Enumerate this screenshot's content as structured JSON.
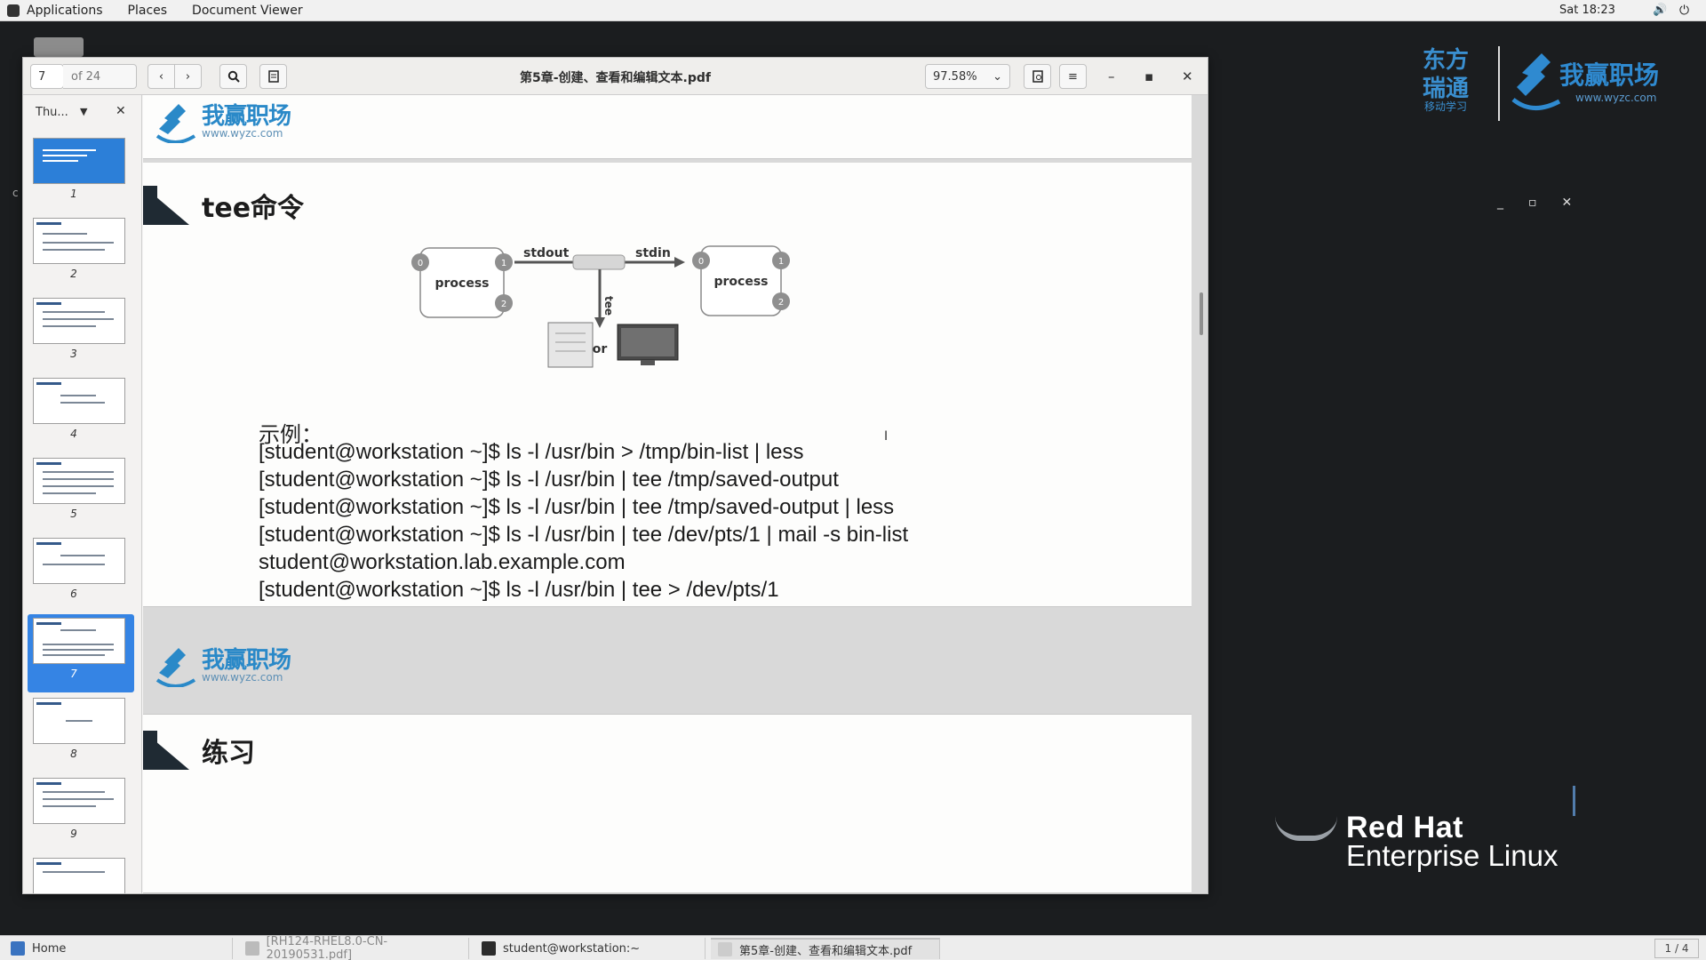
{
  "topbar": {
    "applications": "Applications",
    "places": "Places",
    "app_name": "Document Viewer",
    "clock": "Sat 18:23",
    "volume_icon": "speaker-icon",
    "power_icon": "power-icon"
  },
  "desktop": {
    "brand_left_cn": [
      "东方",
      "瑞通"
    ],
    "brand_left_small": "移动学习",
    "brand_right_cn": "我赢职场",
    "brand_right_url": "www.wyzc.com",
    "rh_line1": "Red Hat",
    "rh_line2": "Enterprise Linux"
  },
  "viewer": {
    "page_current": "7",
    "page_total": "of 24",
    "title": "第5章-创建、查看和编辑文本.pdf",
    "zoom": "97.58%",
    "sidebar_mode": "Thu...",
    "thumbnails": [
      "1",
      "2",
      "3",
      "4",
      "5",
      "6",
      "7",
      "8",
      "9"
    ],
    "active_thumbnail": "7"
  },
  "slide": {
    "logo_cn": "我赢职场",
    "logo_url": "www.wyzc.com",
    "heading": "tee命令",
    "diagram": {
      "left_process": "process",
      "right_process": "process",
      "stdout": "stdout",
      "stdin": "stdin",
      "tee": "tee",
      "or": "or",
      "port_0": "0",
      "port_1": "1",
      "port_2": "2"
    },
    "example_label": "示例：",
    "commands": [
      "[student@workstation ~]$ ls -l /usr/bin > /tmp/bin-list | less",
      "[student@workstation ~]$ ls -l /usr/bin | tee /tmp/saved-output",
      "[student@workstation ~]$ ls -l /usr/bin | tee /tmp/saved-output | less",
      " [student@workstation ~]$ ls -l /usr/bin | tee /dev/pts/1 | mail -s bin-list",
      "student@workstation.lab.example.com",
      "[student@workstation ~]$ ls -l /usr/bin | tee > /dev/pts/1"
    ],
    "next_heading": "练习"
  },
  "taskbar": {
    "home": "Home",
    "task_pdf1": "[RH124-RHEL8.0-CN-20190531.pdf]",
    "task_terminal": "student@workstation:~",
    "task_pdf2": "第5章-创建、查看和编辑文本.pdf",
    "workspace": "1 / 4"
  },
  "colors": {
    "accent": "#3584e4",
    "brand_blue": "#2a89c8",
    "desktop_bg": "#1b1d1f"
  }
}
